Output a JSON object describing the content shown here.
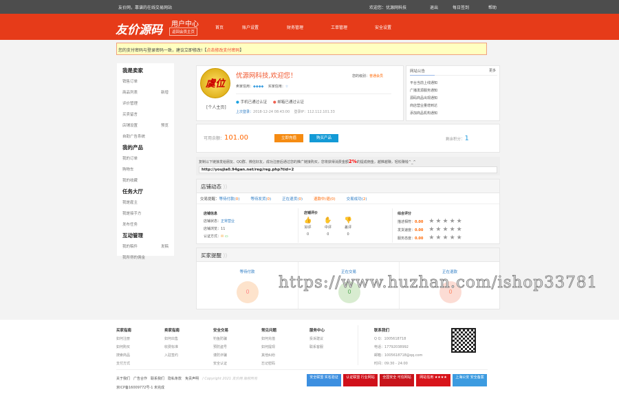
{
  "topbar": {
    "welcome_site": "友价网，靠谱的在线交易网站",
    "user": "欢迎您：优源网科技",
    "logout": "退出",
    "checkin": "每日签到",
    "help": "帮助"
  },
  "nav": {
    "logo": "友价源码",
    "title": "用户中心",
    "back": "返回会员主页",
    "items": [
      "首页",
      "账户设置",
      "财务管理",
      "工单管理",
      "安全设置"
    ]
  },
  "alert": {
    "text": "您的支付密码与登录密码一致，建议立即修改!【",
    "link": "点击修改支付密码",
    "end": "】"
  },
  "sidebar": [
    {
      "heading": "我是卖家",
      "items": [
        [
          "销售订单",
          ""
        ],
        [
          "商品列表",
          "新增"
        ],
        [
          "评价管理",
          ""
        ],
        [
          "买卖留言",
          ""
        ],
        [
          "店铺设置",
          "预览"
        ],
        [
          "自助广告系统",
          ""
        ]
      ]
    },
    {
      "heading": "我的产品",
      "items": [
        [
          "我的订单",
          ""
        ],
        [
          "购物车",
          ""
        ],
        [
          "我的收藏",
          ""
        ]
      ]
    },
    {
      "heading": "任务大厅",
      "items": [
        [
          "我是雇主",
          ""
        ],
        [
          "我是接手方",
          ""
        ],
        [
          "发布任务",
          ""
        ]
      ]
    },
    {
      "heading": "互动管理",
      "items": [
        [
          "我的稿件",
          "发稿"
        ],
        [
          "我所得的佣金",
          ""
        ]
      ]
    }
  ],
  "profile": {
    "avatar_text": "虞位",
    "homepage": "[个人主页]",
    "greeting": "优源网科技,欢迎您！",
    "level_label": "您的级别：",
    "level": "普通会员",
    "seller_credit": "卖家信用：",
    "buyer_credit": "买家信用：",
    "phone_verified": "手机已通过认证",
    "email_verified": "邮箱已通过认证",
    "last_login_label": "上次登录：",
    "last_login": "2018-12-24 08:43:00",
    "ip_label": "登录IP：",
    "ip": "112.112.101.33"
  },
  "notice": {
    "title": "网站公告",
    "more": "更多",
    "items": [
      "平台当前上线通知",
      "广播发源服务通知",
      "源码商品出现通知",
      "商店营业量增到达",
      "添加商品机构通知"
    ]
  },
  "balance": {
    "label": "可用余额：",
    "value": "101.00",
    "recharge": "立即充值",
    "buy": "购买产品",
    "points_label": "剩余积分：",
    "points": "1"
  },
  "referral": {
    "text_pre": "复制以下链接发给朋友、QQ群、微信好友，成功注册后通过您的推广链接购买，您将获得消费金额",
    "percent": "2%",
    "text_post": "的提成佣金，越推越赚，轻松赚钱^_^",
    "url": "http://youjia0.94gan.net/reg/reg.php?tid=2"
  },
  "shop": {
    "title": "店铺动态",
    "reminder_label": "交易提醒：",
    "reminders": [
      [
        "等待付款",
        "0"
      ],
      [
        "等待发货",
        "0"
      ],
      [
        "正在退货",
        "0"
      ],
      [
        "退款中/退",
        "0"
      ],
      [
        "交易成功",
        "2"
      ]
    ],
    "info_title": "店铺信息",
    "status_label": "店铺状态：",
    "status": "正常营业",
    "views_label": "店铺浏览：",
    "views": "11",
    "auth_label": "认证方式：",
    "rating_title": "店铺评价",
    "good": "好评",
    "mid": "中评",
    "bad": "差评",
    "good_n": "0",
    "mid_n": "0",
    "bad_n": "0",
    "score_title": "综合评分",
    "scores": [
      [
        "描述相符：",
        "0.00"
      ],
      [
        "发货速度：",
        "0.00"
      ],
      [
        "服务态度：",
        "0.00"
      ]
    ]
  },
  "buyer": {
    "title": "买家提醒",
    "cols": [
      [
        "等待付款",
        "0"
      ],
      [
        "正在交易",
        "0"
      ],
      [
        "正在退款",
        "0"
      ]
    ]
  },
  "watermark": "https://www.huzhan.com/ishop33781",
  "footer": {
    "cols": [
      {
        "title": "买家指南",
        "items": [
          "如何注册",
          "如何购买",
          "搜索商品",
          "支付方式"
        ]
      },
      {
        "title": "卖家指南",
        "items": [
          "如何出售",
          "收费标准",
          "入驻签约"
        ]
      },
      {
        "title": "安全交易",
        "items": [
          "钓鱼防骗",
          "预防盗号",
          "谨防诈骗",
          "安全认证"
        ]
      },
      {
        "title": "常见问题",
        "items": [
          "如何充值",
          "如何提现",
          "其他纠纷",
          "忘记密码"
        ]
      },
      {
        "title": "服务中心",
        "items": [
          "投诉建议",
          "联系客服"
        ]
      }
    ],
    "contact_title": "联系我们",
    "contacts": [
      "Q Q：1005618718",
      "电话：17792038992",
      "邮箱：1005618718@qq.com",
      "时间：09:30 - 24:00"
    ],
    "links": [
      "关于我们",
      "广告合作",
      "联系我们",
      "隐私条款",
      "免责声明"
    ],
    "copyright": "/ Copyright 2021 友价网 版权所有",
    "icp": "京ICP备16009772号-1 未完成",
    "badges": [
      "安全联盟 实名验证",
      "认证联盟 行业网站",
      "全国安全 可信网站",
      "网站信用 ★★★★",
      "上海公安 安全备案"
    ],
    "badge_colors": [
      "#3c8fe0",
      "#d0101a",
      "#c8141b",
      "#d8141b",
      "#3c9be0"
    ]
  }
}
